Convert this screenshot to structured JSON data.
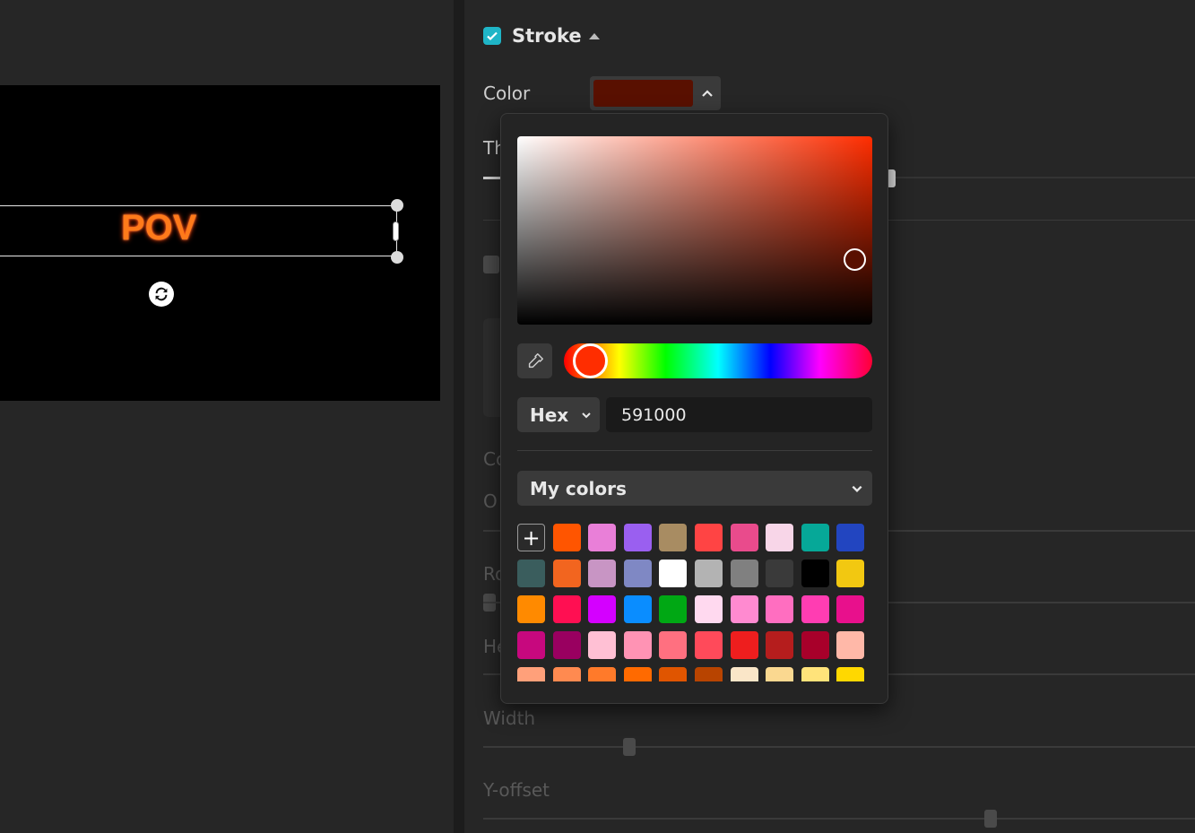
{
  "canvas": {
    "text": "POV"
  },
  "stroke": {
    "label": "Stroke",
    "checked": true,
    "color_label": "Color",
    "color_value": "#591000",
    "thickness_label": "Th",
    "labels_under_popup": [
      "Co",
      "O",
      "Ro",
      "He"
    ]
  },
  "sliders": {
    "width_label": "Width",
    "yoffset_label": "Y-offset"
  },
  "picker": {
    "mode": "Hex",
    "hex_value": "591000",
    "palette_title": "My colors",
    "add_label": "+",
    "swatches": [
      "#ff5500",
      "#e97fd8",
      "#9a5ff0",
      "#a88c62",
      "#ff4444",
      "#e94b8c",
      "#f8d6e8",
      "#06a898",
      "#2245c0",
      "#3a5d5d",
      "#f2651f",
      "#c895c4",
      "#7f88c4",
      "#ffffff",
      "#b3b3b3",
      "#808080",
      "#3a3a3a",
      "#000000",
      "#f2c811",
      "#ff8a00",
      "#ff0f52",
      "#d400ff",
      "#0a8dff",
      "#00a814",
      "#ffd9ef",
      "#ff8ad0",
      "#ff6ec0",
      "#ff3db2",
      "#e8108c",
      "#c7087e",
      "#990060",
      "#ffc0d4",
      "#ff93b4",
      "#ff7080",
      "#ff4a5a",
      "#ee1e1e",
      "#b51d1d",
      "#a8002a",
      "#ffb8a8",
      "#ffa07a",
      "#ff8a50",
      "#ff7a2a",
      "#ff6a00",
      "#e05500",
      "#b84400",
      "#fae6c8",
      "#fad890",
      "#ffe37a",
      "#ffd800"
    ]
  }
}
